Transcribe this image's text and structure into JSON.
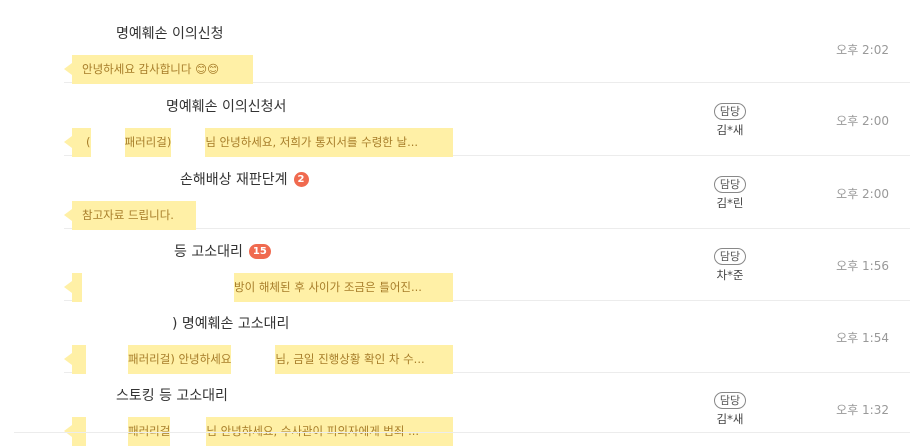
{
  "rows": [
    {
      "title": "명예훼손 이의신청",
      "badge": "",
      "preview": "안녕하세요 감사합니다 😊😊",
      "manager_tag": "",
      "manager_name": "",
      "time": "오후 2:02"
    },
    {
      "title": "명예훼손 이의신청서",
      "badge": "",
      "preview_a": "(",
      "preview_b": "패러리걸)",
      "preview_c": "님 안녕하세요, 저희가 통지서를 수령한 날...",
      "manager_tag": "담당",
      "manager_name": "김*새",
      "time": "오후 2:00"
    },
    {
      "title": "손해배상 재판단계",
      "badge": "2",
      "preview": "참고자료 드립니다.",
      "manager_tag": "담당",
      "manager_name": "김*린",
      "time": "오후 2:00"
    },
    {
      "title": "등 고소대리",
      "badge": "15",
      "preview_c": "방이 해체된 후 사이가 조금은 틀어진...",
      "manager_tag": "담당",
      "manager_name": "차*준",
      "time": "오후 1:56"
    },
    {
      "title": ") 명예훼손 고소대리",
      "badge": "",
      "preview_b": "패러리걸) 안녕하세요",
      "preview_c": "님, 금일 진행상황 확인 차 수...",
      "manager_tag": "",
      "manager_name": "",
      "time": "오후 1:54"
    },
    {
      "title": "스토킹 등 고소대리",
      "badge": "",
      "preview_b": "패러리걸",
      "preview_c": "님 안녕하세요, 수사관이 피의자에게 범죄 ...",
      "manager_tag": "담당",
      "manager_name": "김*새",
      "time": "오후 1:32"
    }
  ]
}
